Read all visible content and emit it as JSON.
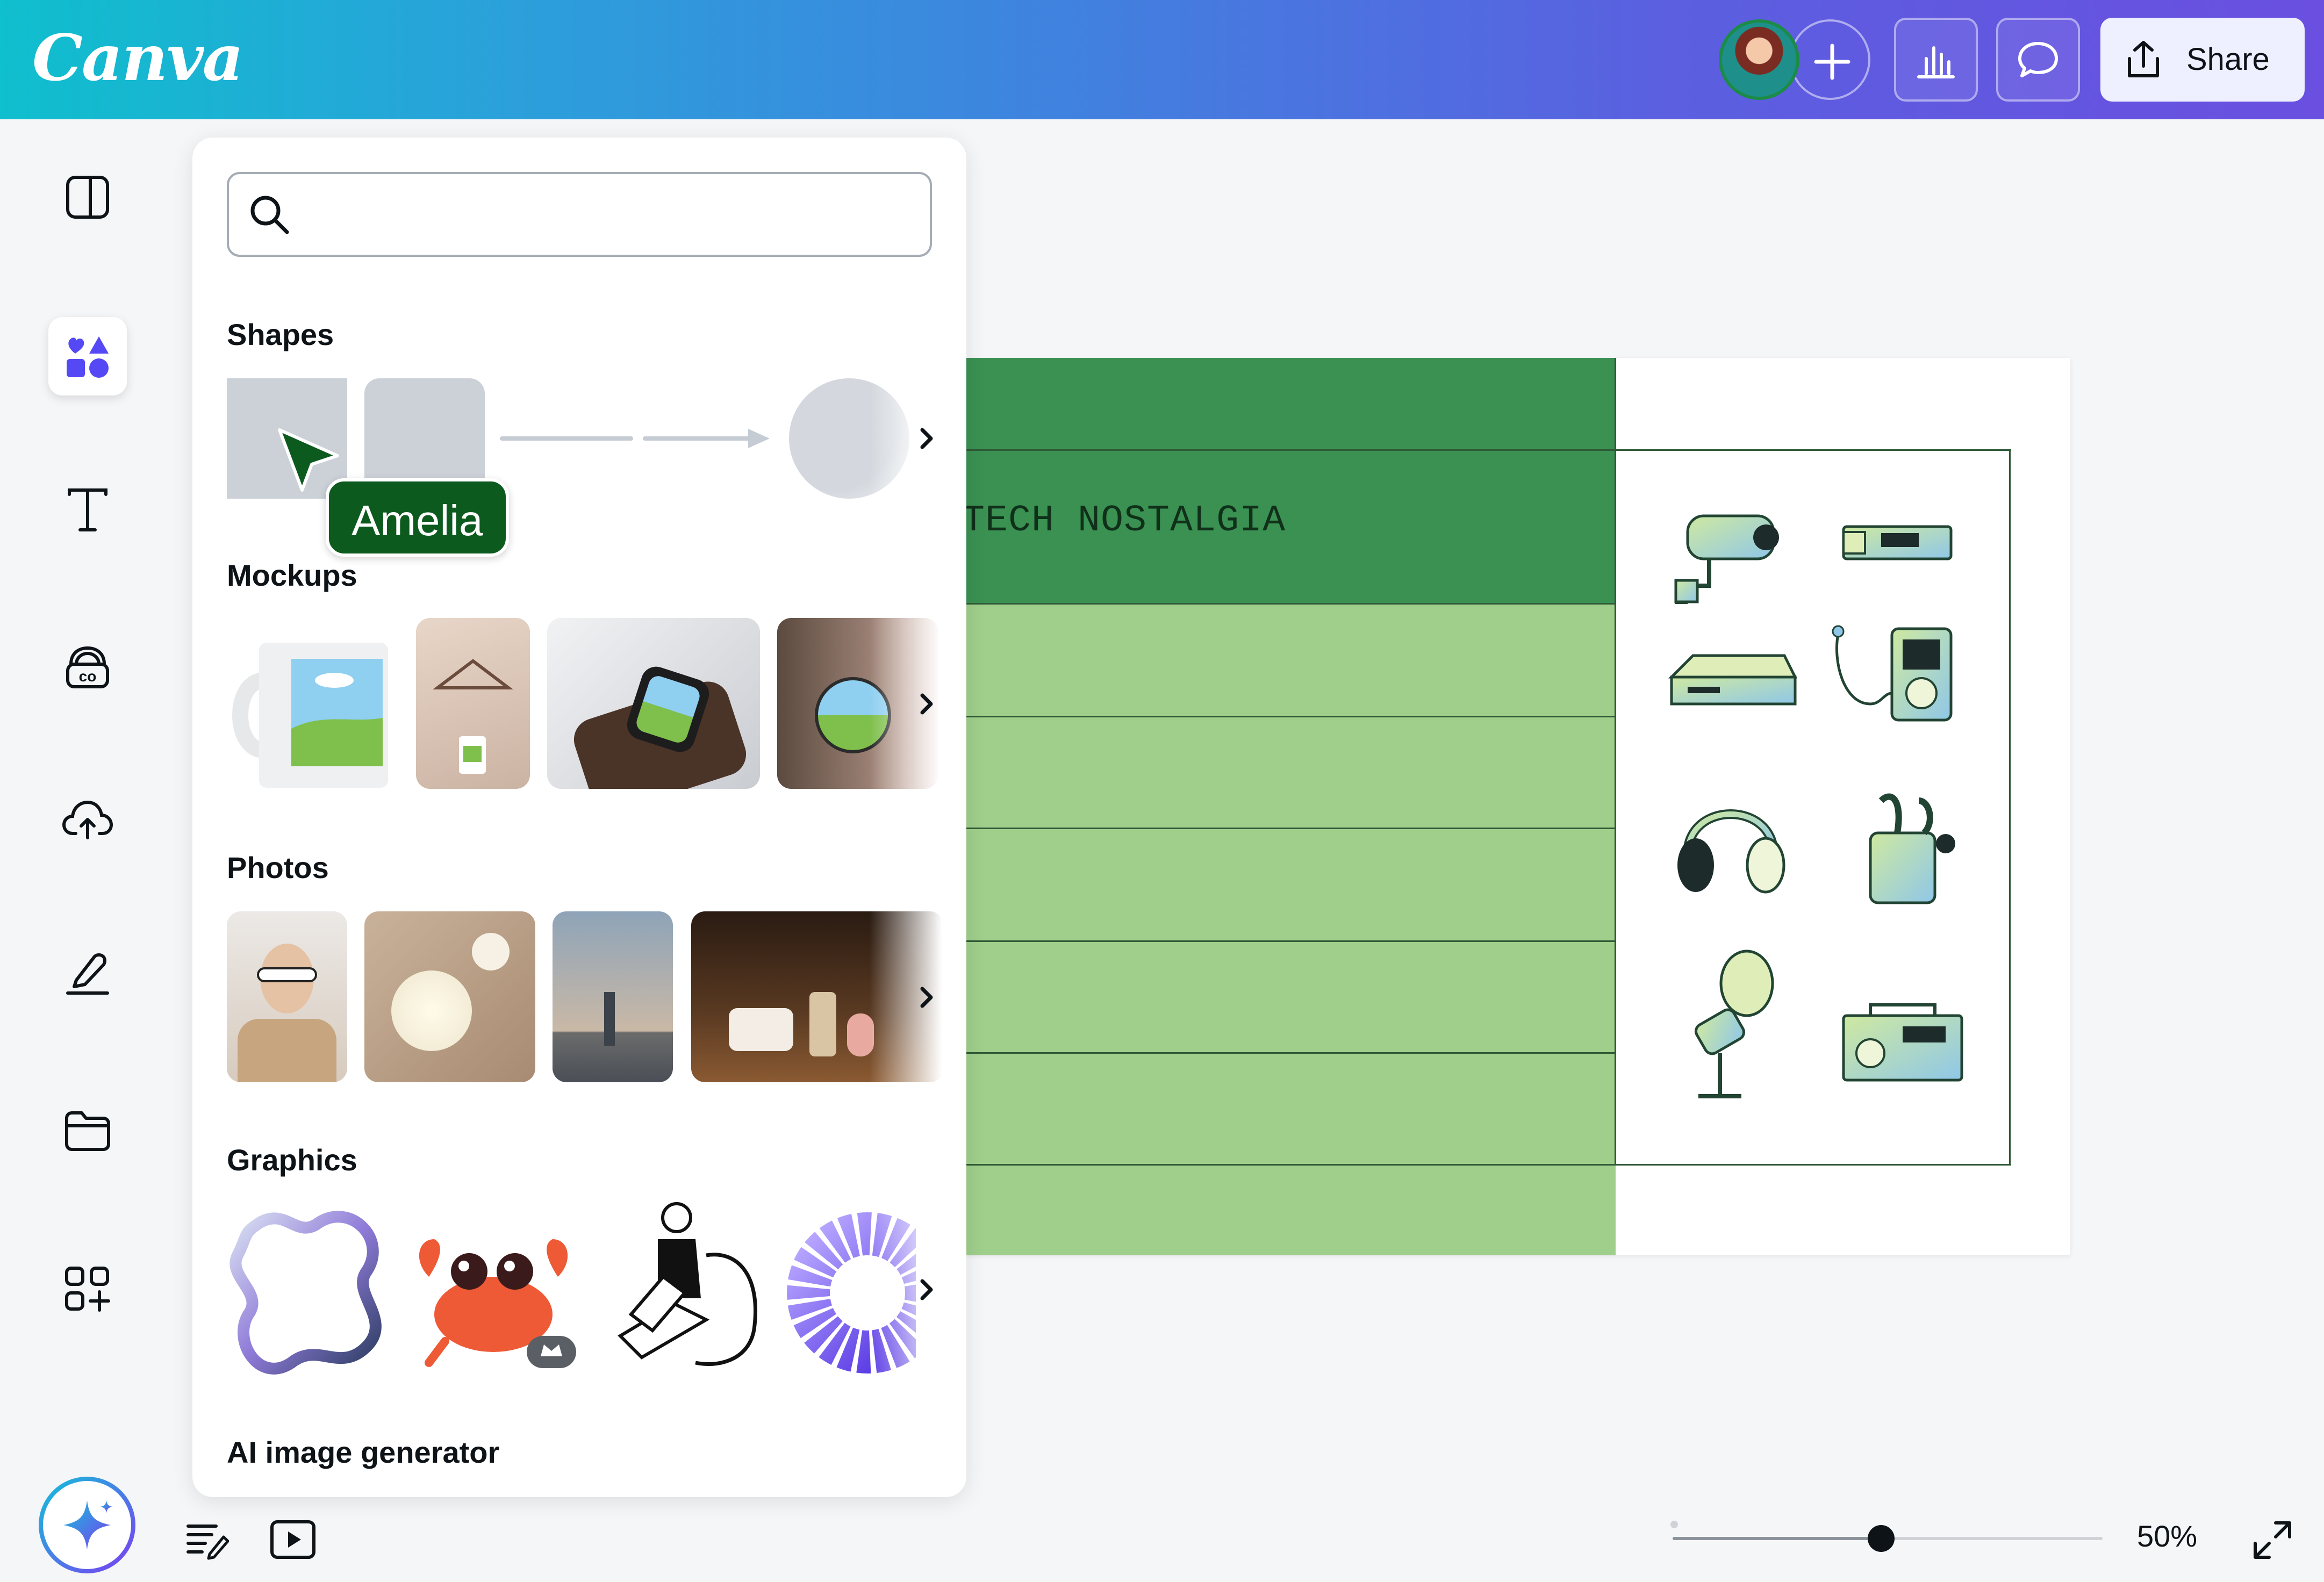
{
  "app": {
    "logo": "Canva"
  },
  "header": {
    "share_label": "Share",
    "icons": [
      "plus-icon",
      "insights-icon",
      "comment-icon",
      "share-upload-icon"
    ]
  },
  "rail": {
    "icons": [
      "design-icon",
      "elements-icon",
      "text-icon",
      "brand-icon",
      "uploads-icon",
      "draw-icon",
      "projects-icon",
      "apps-icon"
    ],
    "active": "elements-icon"
  },
  "panel": {
    "search": {
      "value": "",
      "placeholder": ""
    },
    "sections": {
      "shapes": "Shapes",
      "mockups": "Mockups",
      "photos": "Photos",
      "graphics": "Graphics",
      "ai": "AI image generator"
    }
  },
  "collaborator": {
    "name": "Amelia"
  },
  "canvas": {
    "title": "TECH NOSTALGIA"
  },
  "footer": {
    "zoom": "50%",
    "zoom_fraction": 0.5
  },
  "colors": {
    "green_dark": "#3a9152",
    "green_light": "#9fcf8b",
    "accent": "#7d3cf2",
    "cursor": "#0d5a1e"
  }
}
